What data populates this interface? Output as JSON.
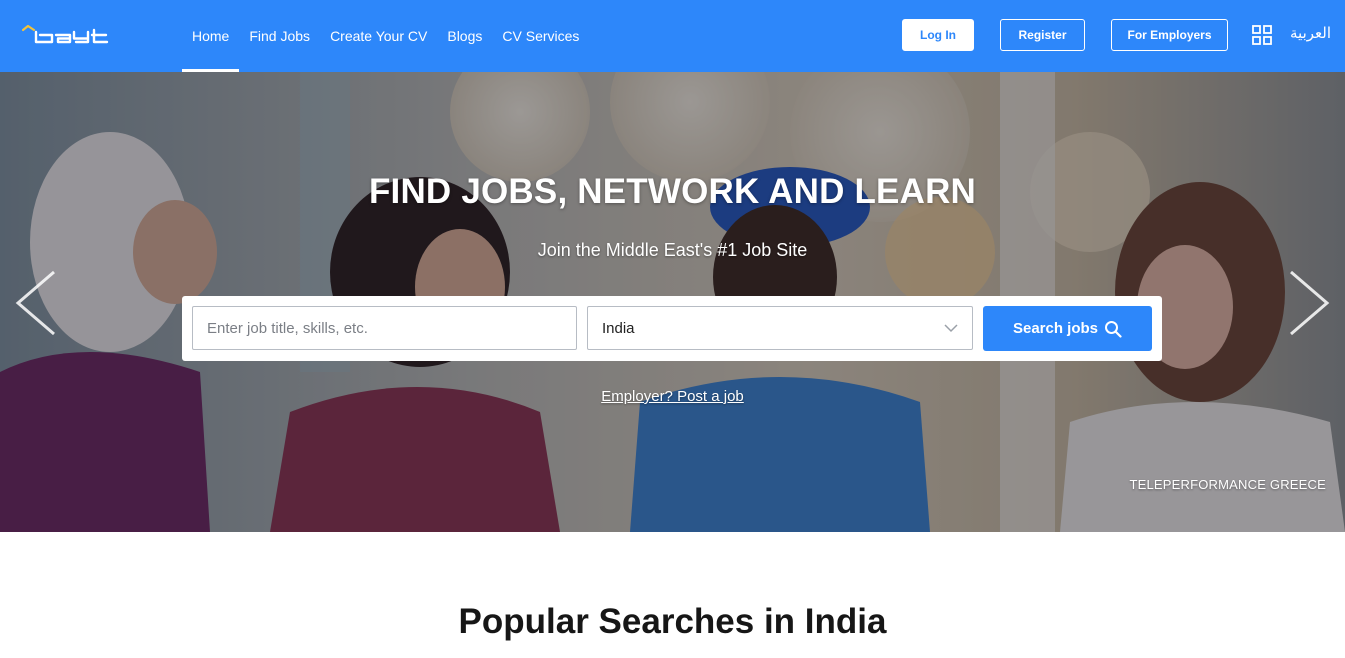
{
  "header": {
    "logo_text": "bayt",
    "nav": [
      {
        "label": "Home",
        "active": true
      },
      {
        "label": "Find Jobs",
        "active": false
      },
      {
        "label": "Create Your CV",
        "active": false
      },
      {
        "label": "Blogs",
        "active": false
      },
      {
        "label": "CV Services",
        "active": false
      }
    ],
    "login_label": "Log In",
    "register_label": "Register",
    "employers_label": "For Employers",
    "apps_icon": "grid-icon",
    "language_label": "العربية"
  },
  "hero": {
    "title": "FIND JOBS, NETWORK AND LEARN",
    "subtitle": "Join the Middle East's #1 Job Site",
    "search": {
      "placeholder": "Enter job title, skills, etc.",
      "value": "",
      "location_value": "India",
      "button_label": "Search jobs"
    },
    "employer_link": "Employer? Post a job",
    "photo_credit": "TELEPERFORMANCE GREECE",
    "prev_icon": "chevron-left-icon",
    "next_icon": "chevron-right-icon"
  },
  "popular": {
    "title": "Popular Searches in India"
  },
  "colors": {
    "brand_blue": "#2d87fa",
    "white": "#ffffff",
    "heading_dark": "#161616"
  }
}
